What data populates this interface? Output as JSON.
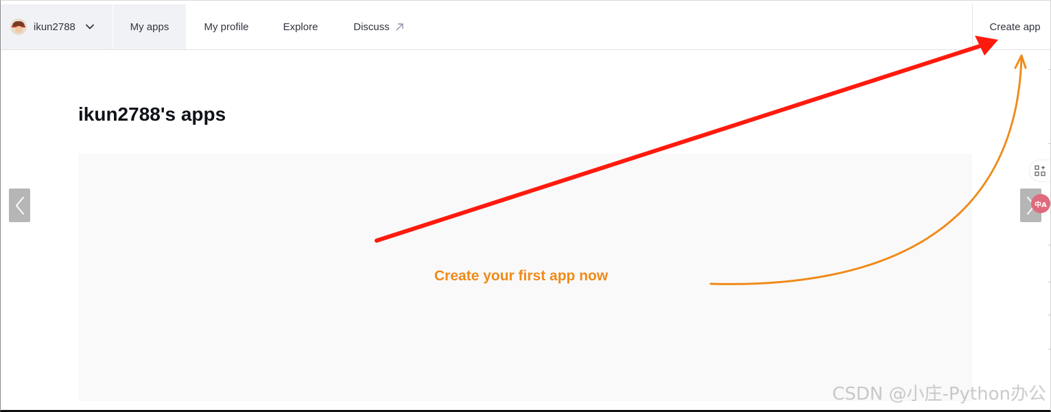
{
  "nav": {
    "username": "ikun2788",
    "my_apps": "My apps",
    "my_profile": "My profile",
    "explore": "Explore",
    "discuss": "Discuss",
    "create_app": "Create app"
  },
  "main": {
    "title": "ikun2788's apps",
    "empty_message": "Create your first app now"
  },
  "side_tools": {
    "translate_label": "中A"
  },
  "watermark": "CSDN @小庄-Python办公",
  "colors": {
    "nav_active_bg": "#f0f2f6",
    "empty_panel_bg": "#f9f9f9",
    "annotation_red": "#ff1a0d",
    "annotation_orange": "#f08a19",
    "text_dark": "#31333f"
  },
  "icons": {
    "user_menu": "chevron-down-icon",
    "discuss": "external-link-icon",
    "carousel_prev": "chevron-left-icon",
    "carousel_next": "chevron-right-icon",
    "side_tool": "apps-grid-icon"
  }
}
